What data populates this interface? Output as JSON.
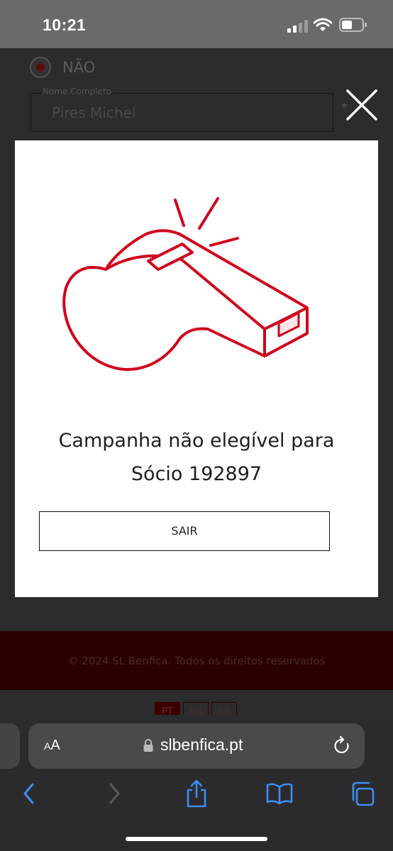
{
  "status_bar": {
    "time": "10:21"
  },
  "background_form": {
    "radio_label": "NÃO",
    "name_field_legend": "Nome Completo",
    "name_field_value": "Pires Michel",
    "required_mark": "*",
    "footer_copyright": "© 2024 SL Benfica. Todos os direitos reservados",
    "languages": [
      "PT",
      "EN",
      "ES"
    ]
  },
  "modal": {
    "icon": "whistle-icon",
    "message_line1": "Campanha não elegível para",
    "message_line2": "Sócio 192897",
    "button_label": "SAIR"
  },
  "browser": {
    "text_size_label_small": "A",
    "text_size_label_large": "A",
    "url": "slbenfica.pt"
  },
  "colors": {
    "accent": "#d0021b",
    "modal_bg": "#ffffff",
    "overlay": "#2c2c2c"
  }
}
